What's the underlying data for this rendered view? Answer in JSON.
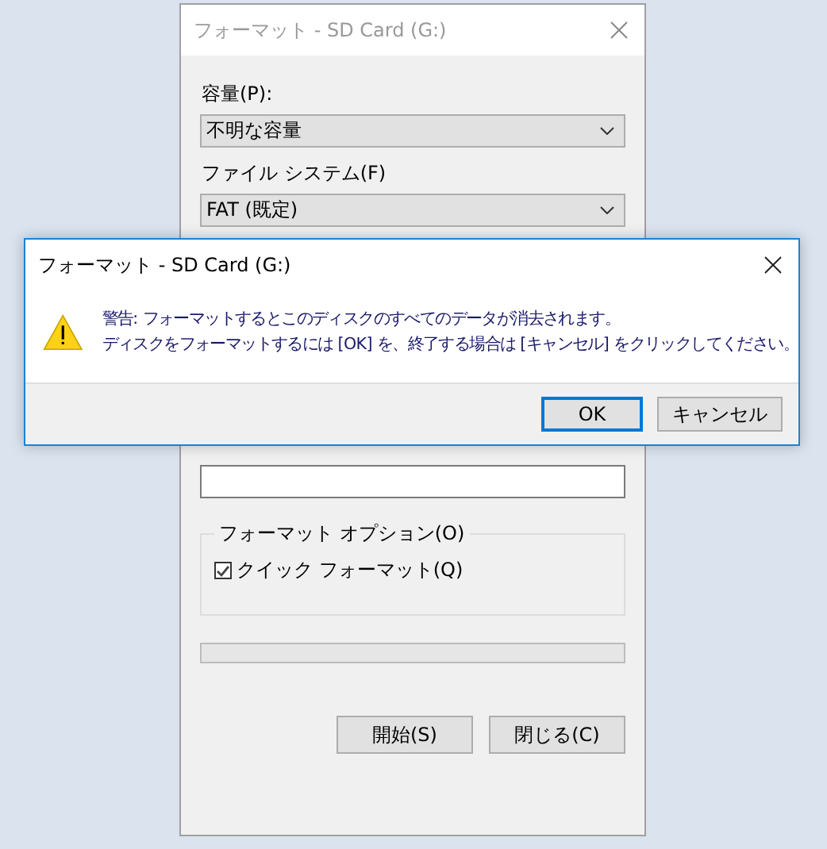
{
  "back_window": {
    "title": "フォーマット - SD Card (G:)",
    "capacity": {
      "label": "容量(P):",
      "value": "不明な容量"
    },
    "file_system": {
      "label": "ファイル システム(F)",
      "value": "FAT (既定)"
    },
    "options": {
      "legend": "フォーマット オプション(O)",
      "quick_format": {
        "label": "クイック フォーマット(Q)",
        "checked": true
      }
    },
    "progress": {
      "level": 0
    },
    "buttons": [
      "開始(S)",
      "閉じる(C)"
    ]
  },
  "dialog": {
    "title": "フォーマット - SD Card (G:)",
    "message_lines": [
      "警告: フォーマットするとこのディスクのすべてのデータが消去されます。",
      "ディスクをフォーマットするには [OK] を、終了する場合は [キャンセル] をクリックしてください。"
    ],
    "buttons": [
      {
        "label": "OK",
        "selected": true
      },
      {
        "label": "キャンセル",
        "selected": false
      }
    ]
  }
}
